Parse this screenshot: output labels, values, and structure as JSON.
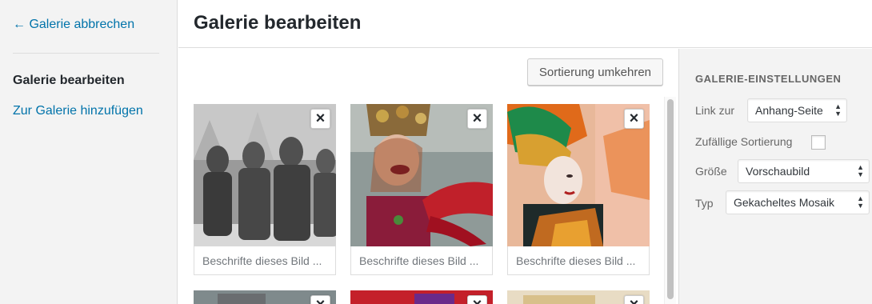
{
  "sidebar": {
    "cancel_label": "← Galerie abbrechen",
    "items": [
      {
        "label": "Galerie bearbeiten"
      },
      {
        "label": "Zur Galerie hinzufügen"
      }
    ]
  },
  "header": {
    "title": "Galerie bearbeiten"
  },
  "toolbar": {
    "reverse_label": "Sortierung umkehren"
  },
  "gallery": {
    "remove_icon": "×",
    "items": [
      {
        "caption_placeholder": "Beschrifte dieses Bild ...",
        "image": "black-and-white parade figures in costumes"
      },
      {
        "caption_placeholder": "Beschrifte dieses Bild ...",
        "image": "laughing performer with headdress"
      },
      {
        "caption_placeholder": "Beschrifte dieses Bild ...",
        "image": "performer in green and orange headdress"
      }
    ],
    "partial_row_count": 3
  },
  "settings": {
    "heading": "GALERIE-EINSTELLUNGEN",
    "link_label": "Link zur",
    "link_value": "Anhang-Seite",
    "random_label": "Zufällige Sortierung",
    "random_checked": false,
    "size_label": "Größe",
    "size_value": "Vorschaubild",
    "type_label": "Typ",
    "type_value": "Gekacheltes Mosaik"
  },
  "colors": {
    "link": "#0073aa",
    "panel_bg": "#f3f3f3",
    "border": "#dddddd"
  }
}
